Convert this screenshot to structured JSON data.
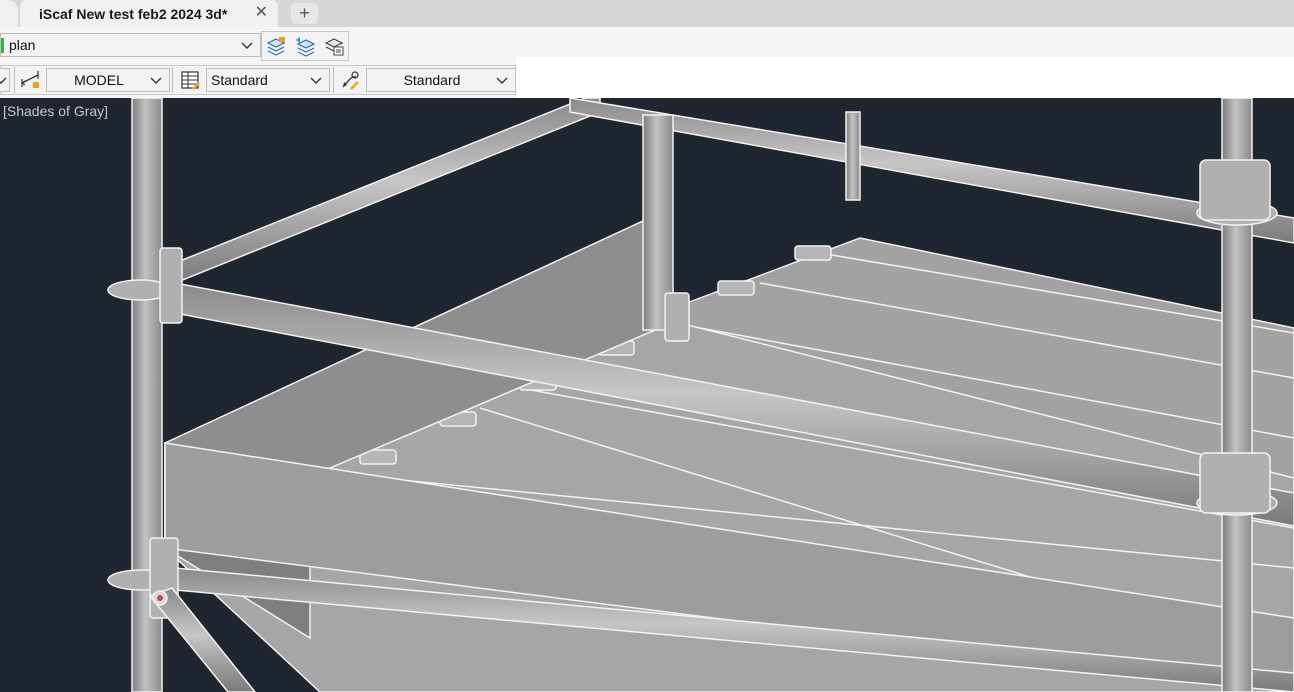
{
  "tabs": {
    "active_title": "iScaf New test feb2 2024 3d*",
    "close_glyph": "✕",
    "add_glyph": "+"
  },
  "toolbar": {
    "layer_value": "plan",
    "layer_color": "#3cb043",
    "space_value": "MODEL",
    "table_style_value": "Standard",
    "multileader_style_value": "Standard"
  },
  "icons": {
    "layer_states": "layer-stack-icon",
    "layer_previous": "layer-previous-icon",
    "layer_match": "layer-match-icon",
    "dimension_style": "dimension-style-icon",
    "table_style": "table-style-icon",
    "multileader_style": "multileader-style-icon"
  },
  "viewport": {
    "visual_style_label": "[Shades of Gray]",
    "background": "#1f2630",
    "model_gray": "#a0a0a0"
  }
}
